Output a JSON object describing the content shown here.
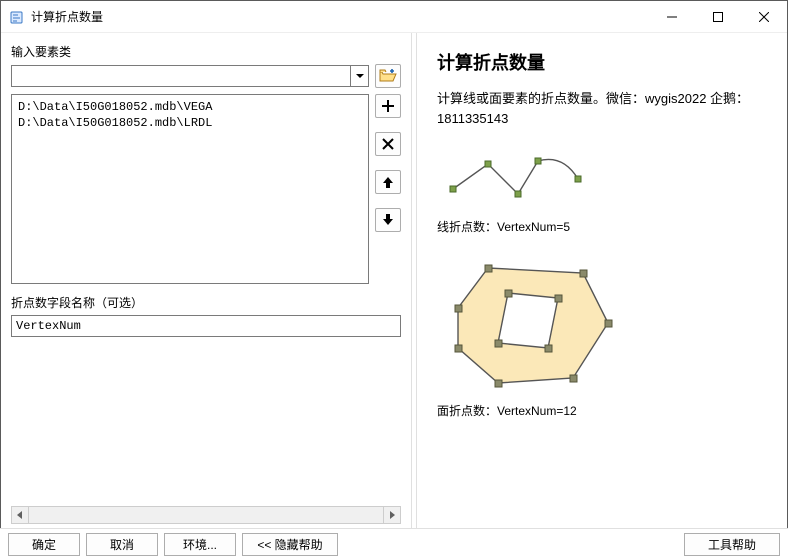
{
  "window": {
    "title": "计算折点数量"
  },
  "left": {
    "input_label": "输入要素类",
    "combo_value": "",
    "items": [
      "D:\\Data\\I50G018052.mdb\\VEGA",
      "D:\\Data\\I50G018052.mdb\\LRDL"
    ],
    "field_name_label": "折点数字段名称（可选）",
    "field_name_value": "VertexNum"
  },
  "help": {
    "title": "计算折点数量",
    "description": "计算线或面要素的折点数量。微信：wygis2022 企鹅：1811335143",
    "caption1": "线折点数：VertexNum=5",
    "caption2": "面折点数：VertexNum=12"
  },
  "buttons": {
    "ok": "确定",
    "cancel": "取消",
    "env": "环境...",
    "hide_help": "<< 隐藏帮助",
    "tool_help": "工具帮助"
  },
  "icons": {
    "browse": "folder-open-icon",
    "add": "plus-icon",
    "remove": "x-icon",
    "up": "arrow-up-icon",
    "down": "arrow-down-icon"
  }
}
